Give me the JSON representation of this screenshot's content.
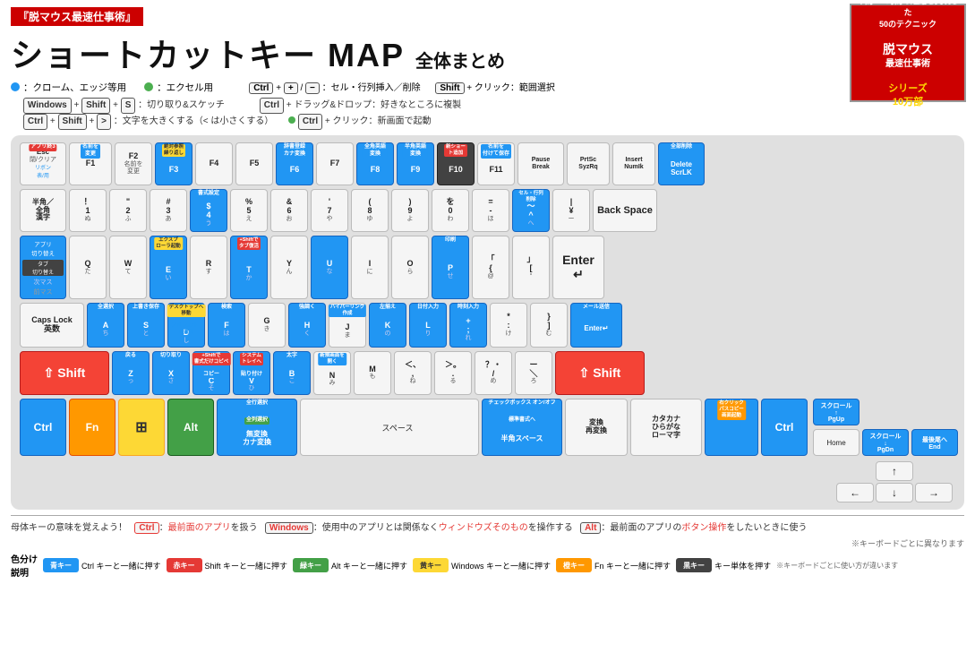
{
  "header": {
    "banner": "『脱マウス最速仕事術』",
    "main_title": "ショートカットキー MAP",
    "sub_title": "全体まとめ"
  },
  "legend": {
    "chrome_label": "：クローム、エッジ等用",
    "excel_label": "：エクセル用"
  },
  "shortcuts": {
    "line1": "Ctrl + + / − ：セル・行列挿入／削除",
    "line2": "Windows + Shift + S：切り取り&スケッチ",
    "line3": "Ctrl + Shift + > ：文字を大きくする（< は小さくする）",
    "line4": "Shift + クリック：範囲選択",
    "line5": "Ctrl + ドラッグ&ドロップ：好きなところに複製",
    "line6": "Ctrl + クリック：新画面で起動"
  },
  "keyboard": {
    "backspace_label": "Back Space"
  },
  "footer": {
    "ctrl_meaning": "Ctrl：最前面のアプリを扱う",
    "win_meaning": "Windows：使用中のアプリとは関係なくウィンドウズそのものを操作する",
    "alt_meaning": "Alt：最前面のアプリのボタン操作をしたいときに使う",
    "note": "※キーボードごとに異なります",
    "color_blue": "青キー",
    "color_blue_desc": "Ctrl キーと一緒に押す",
    "color_red": "赤キー",
    "color_red_desc": "Shift キーと一緒に押す",
    "color_green": "緑キー",
    "color_green_desc": "Alt キーと一緒に押す",
    "color_yellow": "黄キー",
    "color_yellow_desc": "Windows キーと一緒に押す",
    "color_orange": "橙キー",
    "color_orange_desc": "Fn キーと一緒に押す",
    "color_dark": "黒キー",
    "color_dark_desc": "キー単体を押す",
    "color_note": "※キーボードごとに使い方が違います"
  }
}
